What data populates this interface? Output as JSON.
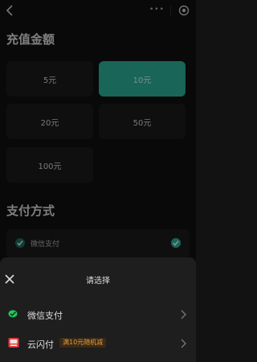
{
  "nav": {
    "back_icon": "chevron-left-icon",
    "capsule_dots": "•••",
    "capsule_icon": "target-icon"
  },
  "recharge": {
    "title": "充值金额",
    "amounts": [
      {
        "label": "5元",
        "selected": false
      },
      {
        "label": "10元",
        "selected": true
      },
      {
        "label": "20元",
        "selected": false
      },
      {
        "label": "50元",
        "selected": false
      },
      {
        "label": "100元",
        "selected": false
      }
    ]
  },
  "payment": {
    "title": "支付方式",
    "method_label": "微信支付",
    "check_icon": "check-circle-icon"
  },
  "sheet": {
    "title": "请选择",
    "close_icon": "close-icon",
    "options": [
      {
        "label": "微信支付",
        "icon": "wechat-pay-icon"
      },
      {
        "label": "云闪付",
        "icon": "unionpay-cloud-icon",
        "badge": "满10元随机减"
      }
    ]
  },
  "colors": {
    "accent": "#2fb8a1",
    "badge_text": "#e49b3f",
    "wechat": "#22c55e",
    "unionpay": "#e23b3b"
  }
}
